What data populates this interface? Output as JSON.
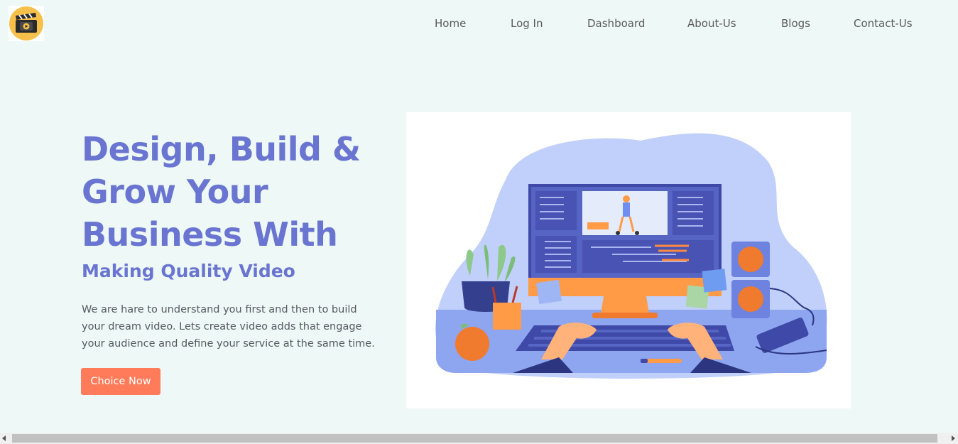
{
  "header": {
    "logo_icon": "clapperboard-play-icon",
    "nav": [
      {
        "label": "Home"
      },
      {
        "label": "Log In"
      },
      {
        "label": "Dashboard"
      },
      {
        "label": "About-Us"
      },
      {
        "label": "Blogs"
      },
      {
        "label": "Contact-Us"
      }
    ]
  },
  "hero": {
    "title": "Design, Build & Grow Your Business With",
    "subtitle": "Making Quality Video",
    "description": "We are hare to understand you first and then to build your dream video. Lets create video adds that engage your audience and define your service at the same time.",
    "cta_label": "Choice Now"
  },
  "illustration": {
    "icon": "video-editing-desk-illustration"
  },
  "colors": {
    "background": "#eef8f6",
    "accent": "#6975d0",
    "cta": "#ff7b5a",
    "text": "#555a60"
  }
}
